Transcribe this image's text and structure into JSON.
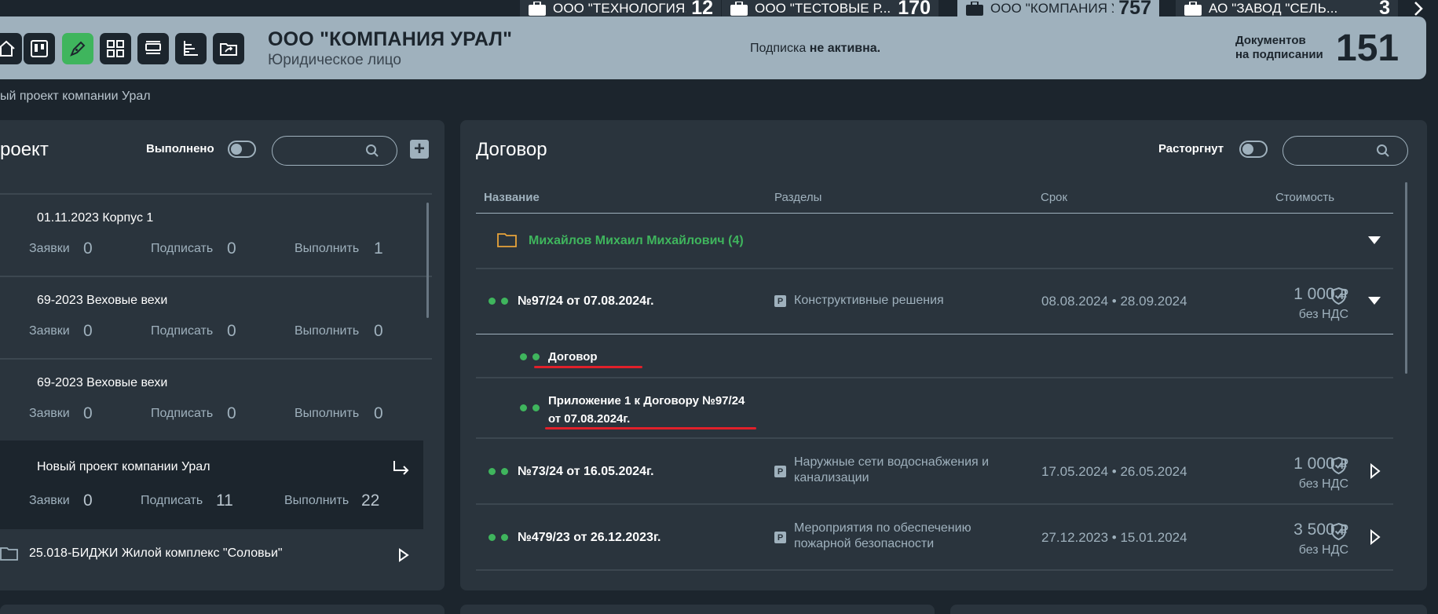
{
  "tabs": [
    {
      "name": "ООО \"ТЕХНОЛОГИЯ...",
      "count": "12",
      "active": false
    },
    {
      "name": "ООО \"ТЕСТОВЫЕ Р...",
      "count": "170",
      "active": false
    },
    {
      "name": "ООО \"КОМПАНИЯ У...",
      "count": "757",
      "active": true
    },
    {
      "name": "АО \"ЗАВОД \"СЕЛЬ...",
      "count": "3",
      "active": false
    }
  ],
  "tab_next_icon": "chevron-right-icon",
  "header": {
    "company_name": "ООО \"КОМПАНИЯ УРАЛ\"",
    "company_type": "Юридическое лицо",
    "subscription_prefix": "Подписка ",
    "subscription_status": "не активна.",
    "docs_label_line1": "Документов",
    "docs_label_line2": "на подписании",
    "docs_count": "151",
    "buttons": [
      "home-icon",
      "kanban-icon",
      "pen-icon",
      "grid-icon",
      "list-icon",
      "tree-icon",
      "folder-share-icon"
    ]
  },
  "breadcrumb": "ый проект компании Урал",
  "left_panel": {
    "title": "роект",
    "toggle_label": "Выполнено",
    "projects": [
      {
        "title": "01.11.2023 Корпус 1",
        "requests_label": "Заявки",
        "requests": "0",
        "sign_label": "Подписать",
        "sign": "0",
        "do_label": "Выполнить",
        "do": "1"
      },
      {
        "title": "69-2023 Веховые вехи",
        "requests_label": "Заявки",
        "requests": "0",
        "sign_label": "Подписать",
        "sign": "0",
        "do_label": "Выполнить",
        "do": "0"
      },
      {
        "title": "69-2023 Веховые вехи",
        "requests_label": "Заявки",
        "requests": "0",
        "sign_label": "Подписать",
        "sign": "0",
        "do_label": "Выполнить",
        "do": "0"
      },
      {
        "title": "Новый проект компании Урал",
        "requests_label": "Заявки",
        "requests": "0",
        "sign_label": "Подписать",
        "sign": "11",
        "do_label": "Выполнить",
        "do": "22"
      }
    ],
    "folder_item": "25.018-БИДЖИ Жилой комплекс \"Соловьи\""
  },
  "right_panel": {
    "title": "Договор",
    "toggle_label": "Расторгнут",
    "columns": {
      "name": "Название",
      "sections": "Разделы",
      "period": "Срок",
      "cost": "Стоимость"
    },
    "folder_group": "Михайлов Михаил Михайлович (4)",
    "rows": [
      {
        "name": "№97/24 от 07.08.2024г.",
        "badge": "Р",
        "section": "Конструктивные решения",
        "period": "08.08.2024 • 28.09.2024",
        "price": "1 000",
        "currency": "₽",
        "vat": "без НДС"
      },
      {
        "name": "№73/24 от 16.05.2024г.",
        "badge": "Р",
        "section_line1": "Наружные сети водоснабжения и",
        "section_line2": "канализации",
        "period": "17.05.2024 • 26.05.2024",
        "price": "1 000",
        "currency": "₽",
        "vat": "без НДС"
      },
      {
        "name": "№479/23 от 26.12.2023г.",
        "badge": "Р",
        "section_line1": "Мероприятия по обеспечению",
        "section_line2": "пожарной безопасности",
        "period": "27.12.2023 • 15.01.2024",
        "price": "3 500",
        "currency": "₽",
        "vat": "без НДС"
      }
    ],
    "subdocs": [
      {
        "name": "Договор"
      },
      {
        "name_line1": "Приложение 1 к Договору №97/24",
        "name_line2": "от 07.08.2024г."
      }
    ]
  },
  "colors": {
    "accent_green": "#3fb55d",
    "header_bg": "#9fb1bd",
    "page_bg": "#1c252d",
    "panel_bg": "#2a343d",
    "highlight_red": "#e0202a",
    "folder_orange": "#e8a33a"
  }
}
